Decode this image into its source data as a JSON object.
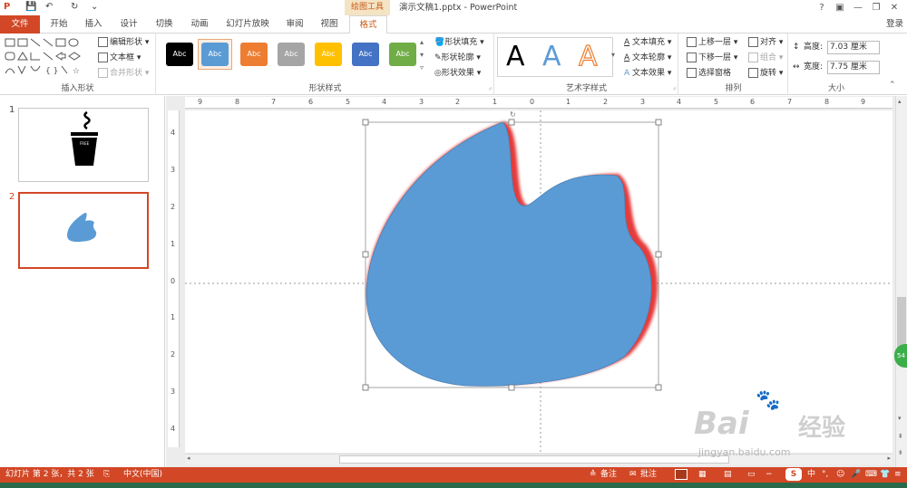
{
  "window": {
    "title": "演示文稿1.pptx - PowerPoint",
    "contextual_tab_group": "绘图工具",
    "help": "?",
    "minimize": "—",
    "restore": "❐",
    "close": "✕"
  },
  "tabs": [
    {
      "label": "文件"
    },
    {
      "label": "开始"
    },
    {
      "label": "插入"
    },
    {
      "label": "设计"
    },
    {
      "label": "切换"
    },
    {
      "label": "动画"
    },
    {
      "label": "幻灯片放映"
    },
    {
      "label": "审阅"
    },
    {
      "label": "视图"
    },
    {
      "label": "格式",
      "active": true
    }
  ],
  "login": "登录",
  "ribbon": {
    "insert_shapes": {
      "label": "插入形状",
      "edit_shape": "编辑形状",
      "text_box": "文本框",
      "merge_shapes": "合并形状"
    },
    "shape_styles": {
      "label": "形状样式",
      "styles": [
        {
          "text": "Abc",
          "color": "#000000"
        },
        {
          "text": "Abc",
          "color": "#5b9bd5",
          "selected": true
        },
        {
          "text": "Abc",
          "color": "#ed7d31"
        },
        {
          "text": "Abc",
          "color": "#a5a5a5"
        },
        {
          "text": "Abc",
          "color": "#ffc000"
        },
        {
          "text": "Abc",
          "color": "#4472c4"
        },
        {
          "text": "Abc",
          "color": "#70ad47"
        }
      ],
      "fill": "形状填充",
      "outline": "形状轮廓",
      "effects": "形状效果"
    },
    "wordart": {
      "label": "艺术字样式",
      "samples": [
        "A",
        "A",
        "A"
      ],
      "text_fill": "文本填充",
      "text_outline": "文本轮廓",
      "text_effects": "文本效果"
    },
    "arrange": {
      "label": "排列",
      "bring_forward": "上移一层",
      "send_backward": "下移一层",
      "selection_pane": "选择窗格",
      "align": "对齐",
      "group": "组合",
      "rotate": "旋转"
    },
    "size": {
      "label": "大小",
      "height_label": "高度:",
      "height_value": "7.03 厘米",
      "width_label": "宽度:",
      "width_value": "7.75 厘米"
    }
  },
  "slides": [
    {
      "number": "1",
      "caption": "FREE"
    },
    {
      "number": "2",
      "selected": true
    }
  ],
  "rulers": {
    "horizontal": [
      "9",
      "8",
      "7",
      "6",
      "5",
      "4",
      "3",
      "2",
      "1",
      "0",
      "1",
      "2",
      "3",
      "4",
      "5",
      "6",
      "7",
      "8",
      "9"
    ],
    "vertical": [
      "4",
      "3",
      "2",
      "1",
      "0",
      "1",
      "2",
      "3",
      "4"
    ]
  },
  "status": {
    "slide_info": "幻灯片 第 2 张，共 2 张",
    "language": "中文(中国)",
    "notes": "备注",
    "comments": "批注",
    "ime": "中"
  },
  "scroll_badge": "54",
  "colors": {
    "accent": "#d24726",
    "shape_fill": "#5b9bd5",
    "shape_shadow": "#e32626"
  },
  "watermark": {
    "brand": "Bai",
    "brand2": "经验",
    "url": "jingyan.baidu.com"
  }
}
